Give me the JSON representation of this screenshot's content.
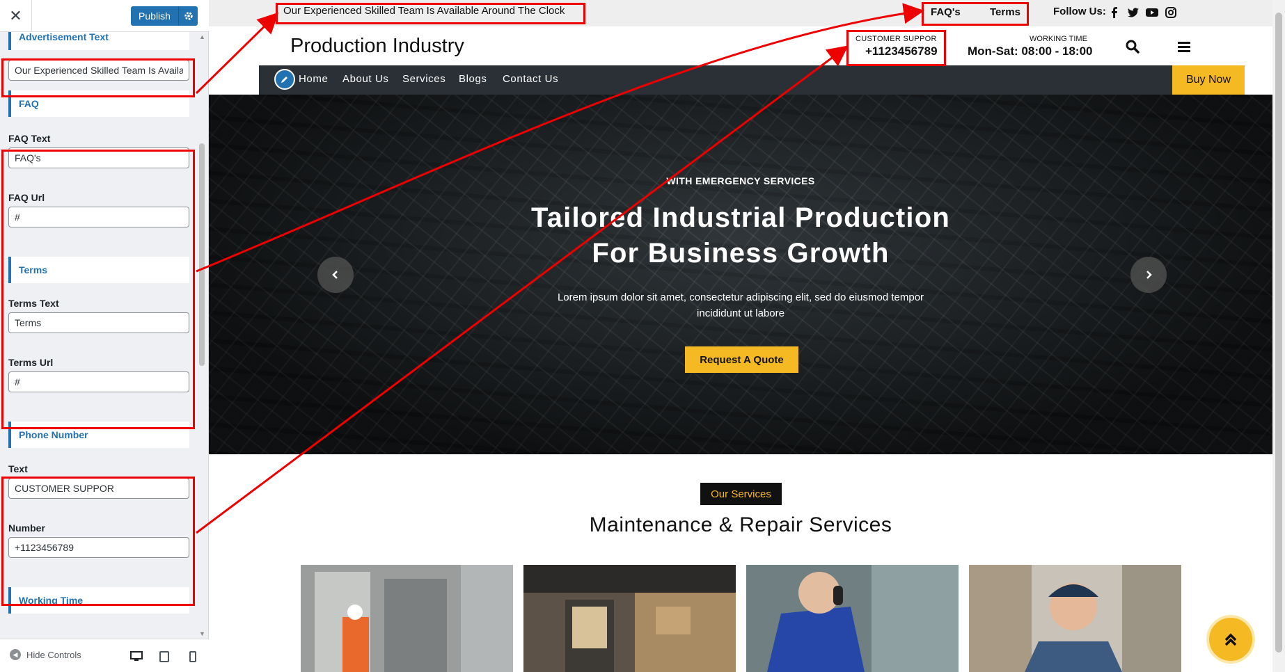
{
  "customizer": {
    "close_icon": "✕",
    "publish_label": "Publish",
    "advertisement_heading": "Advertisement Text",
    "advertisement_value": "Our Experienced Skilled Team Is Available Around The Clock",
    "faq_heading": "FAQ",
    "faq_text_label": "FAQ Text",
    "faq_text_value": "FAQ's",
    "faq_url_label": "FAQ Url",
    "faq_url_value": "#",
    "terms_heading": "Terms",
    "terms_text_label": "Terms Text",
    "terms_text_value": "Terms",
    "terms_url_label": "Terms Url",
    "terms_url_value": "#",
    "phone_heading": "Phone Number",
    "phone_text_label": "Text",
    "phone_text_value": "CUSTOMER SUPPOR",
    "phone_number_label": "Number",
    "phone_number_value": "+1123456789",
    "working_time_heading": "Working Time",
    "hide_controls_label": "Hide Controls"
  },
  "site": {
    "advertisement": "Our Experienced Skilled Team Is Available Around The Clock",
    "faq_link": "FAQ's",
    "terms_link": "Terms",
    "follow_us": "Follow Us:",
    "logo": "Production Industry",
    "support_label": "CUSTOMER SUPPOR",
    "support_number": "+1123456789",
    "working_label": "WORKING TIME",
    "working_value": "Mon-Sat: 08:00 - 18:00",
    "nav": [
      "Home",
      "About Us",
      "Services",
      "Blogs",
      "Contact Us"
    ],
    "buy_now": "Buy Now",
    "hero": {
      "eyebrow": "WITH EMERGENCY SERVICES",
      "title_line1": "Tailored Industrial Production",
      "title_line2": "For Business Growth",
      "text_line1": "Lorem ipsum dolor sit amet, consectetur adipiscing elit, sed do eiusmod tempor",
      "text_line2": "incididunt ut labore",
      "cta": "Request A Quote"
    },
    "services_tag": "Our Services",
    "services_title": "Maintenance & Repair Services"
  },
  "colors": {
    "accent_yellow": "#f4b923",
    "nav_dark": "#2b2f36",
    "wp_blue": "#2271b1",
    "highlight_red": "#e00000"
  },
  "icons": [
    "close-icon",
    "gear-icon",
    "facebook-icon",
    "twitter-icon",
    "youtube-icon",
    "instagram-icon",
    "search-icon",
    "hamburger-menu-icon",
    "pencil-icon",
    "chevron-left-icon",
    "chevron-right-icon",
    "double-chevron-up-icon",
    "desktop-icon",
    "tablet-icon",
    "mobile-icon"
  ]
}
